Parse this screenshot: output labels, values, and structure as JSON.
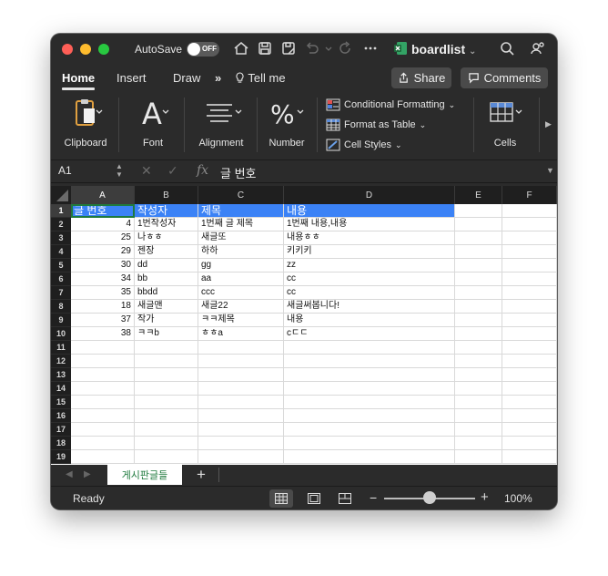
{
  "window": {
    "autosave_label": "AutoSave",
    "autosave_state": "OFF",
    "filename": "boardlist"
  },
  "ribbon_tabs": [
    "Home",
    "Insert",
    "Draw",
    "Tell me"
  ],
  "buttons": {
    "share": "Share",
    "comments": "Comments"
  },
  "ribbon": {
    "clipboard": "Clipboard",
    "font": "Font",
    "alignment": "Alignment",
    "number": "Number",
    "conditional_formatting": "Conditional Formatting",
    "format_as_table": "Format as Table",
    "cell_styles": "Cell Styles",
    "cells": "Cells"
  },
  "formula_bar": {
    "name_box": "A1",
    "fx": "fx",
    "content": "글 번호"
  },
  "columns": [
    "A",
    "B",
    "C",
    "D",
    "E",
    "F"
  ],
  "rows": [
    "1",
    "2",
    "3",
    "4",
    "5",
    "6",
    "7",
    "8",
    "9",
    "10",
    "11",
    "12",
    "13",
    "14",
    "15",
    "16",
    "17",
    "18",
    "19"
  ],
  "table": {
    "headers": [
      "글 번호",
      "작성자",
      "제목",
      "내용"
    ],
    "rows": [
      [
        "4",
        "1번작성자",
        "1번째 글 제목",
        "1번째 내용,내용"
      ],
      [
        "25",
        "나ㅎㅎ",
        "새글또",
        "내용ㅎㅎ"
      ],
      [
        "29",
        "젠장",
        "하하",
        "키키키"
      ],
      [
        "30",
        "dd",
        "gg",
        "zz"
      ],
      [
        "34",
        "bb",
        "aa",
        "cc"
      ],
      [
        "35",
        "bbdd",
        "ccc",
        "cc"
      ],
      [
        "18",
        "새글맨",
        "새글22",
        "새글써봅니다!"
      ],
      [
        "37",
        "작가",
        "ㅋㅋ제목",
        "내용"
      ],
      [
        "38",
        "ㅋㅋb",
        "ㅎㅎa",
        "cㄷㄷ"
      ]
    ]
  },
  "sheet": {
    "tab_name": "게시판글들",
    "add": "+"
  },
  "status": {
    "ready": "Ready",
    "zoom": "100%",
    "zoom_minus": "−",
    "zoom_plus": "+",
    "zoom_level": 0.5
  },
  "colors": {
    "accent": "#3b82f6",
    "excel_green": "#1f7a3e",
    "chrome": "#2b2b2b"
  }
}
